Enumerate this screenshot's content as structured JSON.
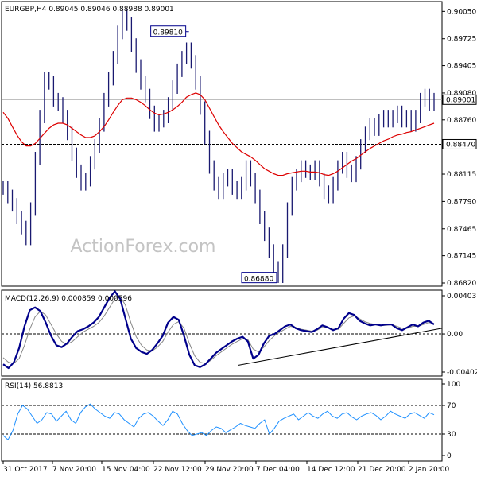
{
  "chart_data": [
    {
      "type": "line",
      "panel": "price",
      "title": "EURGBP,H4  0.89045 0.89046 0.88988 0.89001",
      "watermark": "ActionForex.com",
      "ylim": [
        0.8682,
        0.9011
      ],
      "yticks": [
        "0.90050",
        "0.89725",
        "0.89405",
        "0.89080",
        "0.88760",
        "0.88435",
        "0.88115",
        "0.87790",
        "0.87465",
        "0.87145",
        "0.86820"
      ],
      "current_price": {
        "value": 0.89001,
        "label": "0.89001"
      },
      "level_line": {
        "value": 0.8847,
        "label": "0.88470"
      },
      "annotations": [
        {
          "label": "0.89810",
          "value": 0.8981
        },
        {
          "label": "0.86880",
          "value": 0.8688
        }
      ],
      "series": [
        {
          "values": [
            0.8795,
            0.8785,
            0.8775,
            0.876,
            0.8748,
            0.8735,
            0.877,
            0.883,
            0.888,
            0.8925,
            0.892,
            0.89,
            0.8895,
            0.888,
            0.886,
            0.8835,
            0.8815,
            0.88,
            0.8805,
            0.8825,
            0.8845,
            0.887,
            0.89,
            0.8925,
            0.895,
            0.898,
            0.9,
            0.899,
            0.8965,
            0.894,
            0.892,
            0.8905,
            0.8885,
            0.887,
            0.8875,
            0.888,
            0.8895,
            0.8915,
            0.8935,
            0.895,
            0.896,
            0.8945,
            0.892,
            0.889,
            0.8855,
            0.882,
            0.88,
            0.879,
            0.8805,
            0.881,
            0.8795,
            0.879,
            0.88,
            0.882,
            0.8805,
            0.8785,
            0.876,
            0.874,
            0.872,
            0.87,
            0.869,
            0.872,
            0.877,
            0.88,
            0.881,
            0.882,
            0.8815,
            0.8812,
            0.882,
            0.8805,
            0.879,
            0.8785,
            0.88,
            0.882,
            0.883,
            0.8815,
            0.881,
            0.8825,
            0.8845,
            0.886,
            0.887,
            0.8865,
            0.8875,
            0.888,
            0.8875,
            0.888,
            0.8885,
            0.8875,
            0.888,
            0.887,
            0.888,
            0.89,
            0.8905,
            0.8895,
            0.89
          ]
        },
        {
          "values": [
            0.8885,
            0.8878,
            0.8868,
            0.8858,
            0.885,
            0.8845,
            0.8845,
            0.8848,
            0.8854,
            0.886,
            0.8866,
            0.887,
            0.8872,
            0.8872,
            0.887,
            0.8866,
            0.8862,
            0.8858,
            0.8855,
            0.8855,
            0.8857,
            0.8862,
            0.8868,
            0.8876,
            0.8885,
            0.8893,
            0.89,
            0.8902,
            0.8902,
            0.89,
            0.8897,
            0.8893,
            0.8888,
            0.8884,
            0.8882,
            0.8883,
            0.8885,
            0.8888,
            0.8892,
            0.8897,
            0.8903,
            0.8906,
            0.8908,
            0.8906,
            0.89,
            0.889,
            0.888,
            0.887,
            0.8862,
            0.8855,
            0.8848,
            0.8843,
            0.8838,
            0.8835,
            0.8832,
            0.8828,
            0.8823,
            0.8818,
            0.8815,
            0.8812,
            0.881,
            0.881,
            0.8812,
            0.8813,
            0.8814,
            0.8815,
            0.8815,
            0.8814,
            0.8814,
            0.8813,
            0.8811,
            0.881,
            0.8812,
            0.8815,
            0.8819,
            0.8823,
            0.8827,
            0.883,
            0.8834,
            0.8838,
            0.8842,
            0.8845,
            0.8848,
            0.8851,
            0.8853,
            0.8856,
            0.8858,
            0.8859,
            0.8861,
            0.8862,
            0.8864,
            0.8866,
            0.8868,
            0.887,
            0.8872
          ]
        }
      ]
    },
    {
      "type": "line",
      "panel": "macd",
      "title": "MACD(12,26,9) 0.000859 0.000596",
      "ylim": [
        -0.004021,
        0.00403
      ],
      "yticks": [
        "0.00403",
        "0.00",
        "-0.004021"
      ],
      "trendline_label": "",
      "series": [
        {
          "values": [
            -0.0032,
            -0.0036,
            -0.003,
            -0.0015,
            0.0008,
            0.0025,
            0.0028,
            0.0024,
            0.0012,
            -0.0002,
            -0.0012,
            -0.0014,
            -0.001,
            -0.0003,
            0.0003,
            0.0005,
            0.0008,
            0.0012,
            0.0018,
            0.0028,
            0.0038,
            0.0045,
            0.0037,
            0.0016,
            -0.0005,
            -0.0015,
            -0.0019,
            -0.0021,
            -0.0017,
            -0.001,
            -0.0002,
            0.0012,
            0.0018,
            0.0015,
            -0.0002,
            -0.0022,
            -0.0033,
            -0.0035,
            -0.0032,
            -0.0026,
            -0.002,
            -0.0016,
            -0.0012,
            -0.0008,
            -0.0005,
            -0.0003,
            -0.0008,
            -0.0026,
            -0.0022,
            -0.001,
            -0.0002,
            0.0,
            0.0004,
            0.0008,
            0.001,
            0.0006,
            0.0004,
            0.0003,
            0.0002,
            0.0005,
            0.0009,
            0.0007,
            0.0004,
            0.0006,
            0.0016,
            0.0022,
            0.002,
            0.0014,
            0.0011,
            0.0009,
            0.001,
            0.0009,
            0.001,
            0.001,
            0.0006,
            0.0004,
            0.0007,
            0.001,
            0.0008,
            0.0012,
            0.0014,
            0.001
          ]
        },
        {
          "values": [
            -0.0025,
            -0.003,
            -0.0031,
            -0.0026,
            -0.0012,
            0.0005,
            0.0018,
            0.0024,
            0.002,
            0.001,
            0.0,
            -0.0008,
            -0.0011,
            -0.0008,
            -0.0003,
            0.0002,
            0.0005,
            0.0008,
            0.0012,
            0.0019,
            0.0028,
            0.0037,
            0.004,
            0.003,
            0.0012,
            -0.0003,
            -0.0012,
            -0.0017,
            -0.0018,
            -0.0014,
            -0.0008,
            0.0002,
            0.001,
            0.0013,
            0.0006,
            -0.001,
            -0.0023,
            -0.003,
            -0.0031,
            -0.0028,
            -0.0023,
            -0.0019,
            -0.0015,
            -0.0011,
            -0.0008,
            -0.0005,
            -0.0006,
            -0.0016,
            -0.0019,
            -0.0014,
            -0.0007,
            -0.0002,
            0.0002,
            0.0005,
            0.0008,
            0.0007,
            0.0005,
            0.0004,
            0.0003,
            0.0004,
            0.0007,
            0.0007,
            0.0005,
            0.0005,
            0.0011,
            0.0017,
            0.0019,
            0.0016,
            0.0013,
            0.0011,
            0.001,
            0.0009,
            0.0009,
            0.001,
            0.0008,
            0.0006,
            0.0006,
            0.0008,
            0.0008,
            0.001,
            0.0012,
            0.0011
          ]
        }
      ]
    },
    {
      "type": "line",
      "panel": "rsi",
      "title": "RSI(14) 56.8813",
      "ylim": [
        0,
        100
      ],
      "yticks": [
        "100",
        "70",
        "30",
        "0"
      ],
      "levels": [
        70,
        30
      ],
      "categories": [
        "31 Oct 2017",
        "7 Nov 20:00",
        "15 Nov 04:00",
        "22 Nov 12:00",
        "29 Nov 20:00",
        "7 Dec 04:00",
        "14 Dec 12:00",
        "21 Dec 20:00",
        "2 Jan 20:00"
      ],
      "series": [
        {
          "values": [
            28,
            22,
            35,
            58,
            70,
            65,
            55,
            45,
            50,
            60,
            58,
            48,
            55,
            62,
            50,
            45,
            60,
            68,
            72,
            65,
            60,
            55,
            52,
            60,
            58,
            50,
            45,
            40,
            52,
            58,
            60,
            55,
            48,
            42,
            50,
            62,
            58,
            45,
            35,
            28,
            30,
            32,
            28,
            35,
            40,
            38,
            32,
            36,
            40,
            45,
            42,
            40,
            38,
            45,
            50,
            30,
            38,
            48,
            52,
            55,
            58,
            50,
            55,
            60,
            55,
            52,
            58,
            62,
            55,
            52,
            58,
            60,
            54,
            50,
            55,
            58,
            60,
            56,
            50,
            55,
            62,
            58,
            55,
            52,
            58,
            60,
            56,
            52,
            60,
            57
          ]
        }
      ]
    }
  ],
  "colors": {
    "price": "#191970",
    "ma": "#dd0000",
    "macd": "#00008b",
    "signal": "#888888",
    "rsi": "#1e90ff",
    "grid": "#000000"
  }
}
